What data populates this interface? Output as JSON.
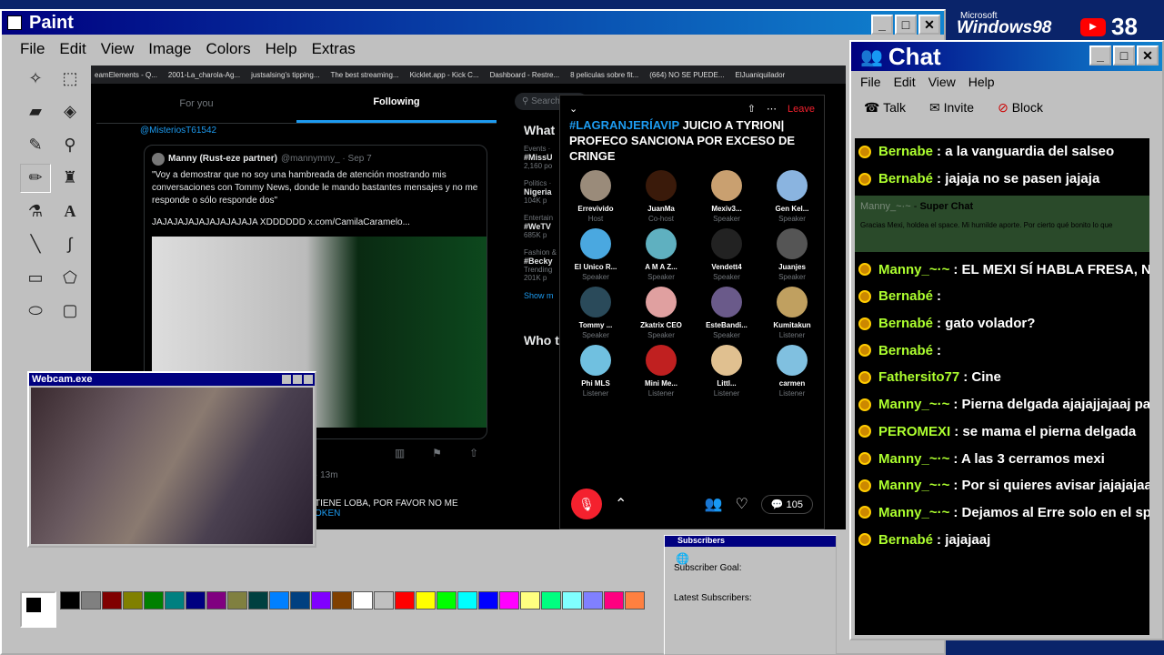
{
  "desktop": {
    "brand_top": "Microsoft",
    "brand": "Windows98",
    "youtube_count": "38"
  },
  "paint": {
    "title": "Paint",
    "menu": [
      "File",
      "Edit",
      "View",
      "Image",
      "Colors",
      "Help",
      "Extras"
    ],
    "palette": [
      "#000000",
      "#808080",
      "#800000",
      "#808000",
      "#008000",
      "#008080",
      "#000080",
      "#800080",
      "#808040",
      "#004040",
      "#0080ff",
      "#004080",
      "#8000ff",
      "#804000",
      "#ffffff",
      "#c0c0c0",
      "#ff0000",
      "#ffff00",
      "#00ff00",
      "#00ffff",
      "#0000ff",
      "#ff00ff",
      "#ffff80",
      "#00ff80",
      "#80ffff",
      "#8080ff",
      "#ff0080",
      "#ff8040"
    ]
  },
  "browser": {
    "bookmarks": [
      "eamElements - Q...",
      "2001-La_charola-Ag...",
      "justsalsing's tipping...",
      "The best streaming...",
      "Kicklet.app - Kick C...",
      "Dashboard - Restre...",
      "8 peliculas sobre fit...",
      "(664) NO SE PUEDE...",
      "ElJuaniquilador"
    ],
    "tabs": [
      "For you",
      "Following"
    ],
    "mention": "@MisteriosT61542",
    "tweet_author": "Manny (Rust-eze partner)",
    "tweet_handle": "@mannymny_ · Sep 7",
    "tweet_text": "\"Voy a demostrar que no soy una hambreada de atención mostrando mis conversaciones con Tommy News, donde le mando bastantes mensajes y no me responde o sólo responde dos\"",
    "tweet_laugh": "JAJAJAJAJAJAJAJAJAJA XDDDDDD  x.com/CamilaCaramelo...",
    "tweet2_time": "· 13m",
    "tweet2_text": "TIENE LOBA, POR FAVOR NO ME",
    "tweet2_link": "OKEN",
    "search": "Search",
    "trends_title": "What",
    "trends": [
      {
        "cat": "Events ·",
        "tag": "#MissU",
        "count": "2,160 po"
      },
      {
        "cat": "Politics ·",
        "tag": "Nigeria",
        "count": "104K p"
      },
      {
        "cat": "Entertain",
        "tag": "#WeTV",
        "count": "685K p"
      },
      {
        "cat": "Fashion &",
        "tag": "#Becky",
        "count": "Trending"
      },
      {
        "cat": "",
        "tag": "",
        "count": "201K p"
      }
    ],
    "show_more": "Show m",
    "who_to_follow": "Who t"
  },
  "space": {
    "leave": "Leave",
    "hashtag": "#LAGRANJERÍAVIP",
    "title_rest": "JUICIO A TYRION| PROFECO SANCIONA POR EXCESO DE CRINGE",
    "participants": [
      {
        "name": "Errevivido",
        "role": "Host"
      },
      {
        "name": "JuanMa",
        "role": "Co-host"
      },
      {
        "name": "Mexiv3...",
        "role": "Speaker"
      },
      {
        "name": "Gen Kel...",
        "role": "Speaker"
      },
      {
        "name": "El Unico R...",
        "role": "Speaker"
      },
      {
        "name": "A M A Z...",
        "role": "Speaker"
      },
      {
        "name": "Vendett4",
        "role": "Speaker"
      },
      {
        "name": "Juanjes",
        "role": "Speaker"
      },
      {
        "name": "Tommy ...",
        "role": "Speaker"
      },
      {
        "name": "Zkatrix CEO",
        "role": "Speaker"
      },
      {
        "name": "EsteBandi...",
        "role": "Speaker"
      },
      {
        "name": "Kumitakun",
        "role": "Listener"
      },
      {
        "name": "Phi MLS",
        "role": "Listener"
      },
      {
        "name": "Mini Me...",
        "role": "Listener"
      },
      {
        "name": "Littl...",
        "role": "Listener"
      },
      {
        "name": "carmen",
        "role": "Listener"
      }
    ],
    "comment_count": "105"
  },
  "webcam": {
    "title": "Webcam.exe"
  },
  "subscribers": {
    "title": "Subscribers",
    "goal": "Subscriber Goal:",
    "latest": "Latest Subscribers:"
  },
  "chat": {
    "title": "Chat",
    "menu": [
      "File",
      "Edit",
      "View",
      "Help"
    ],
    "actions": [
      "Talk",
      "Invite",
      "Block"
    ],
    "superchat": {
      "user": "Manny_~·~",
      "label": "Super Chat",
      "text": "Gracias Mexi, holdea el space. Mi humilde aporte. Por cierto qué bonito lo que"
    },
    "messages_top": [
      {
        "user": "Bernabe",
        "text": ": a la vanguardia del salseo"
      },
      {
        "user": "Bernabé",
        "text": ":  jajaja no se pasen jajaja"
      }
    ],
    "messages": [
      {
        "user": "Manny_~·~",
        "text": ": EL MEXI SÍ HABLA FRESA, NO T"
      },
      {
        "user": "Bernabé",
        "text": ":"
      },
      {
        "user": "Bernabé",
        "text": ": gato volador?"
      },
      {
        "user": "Bernabé",
        "text": ":"
      },
      {
        "user": "Fathersito77",
        "text": ": Cine"
      },
      {
        "user": "Manny_~·~",
        "text": ": Pierna delgada ajajajjajaaj pare"
      },
      {
        "user": "PEROMEXI",
        "text": ": se mama el pierna delgada"
      },
      {
        "user": "Manny_~·~",
        "text": ": A las 3 cerramos mexi"
      },
      {
        "user": "Manny_~·~",
        "text": ": Por si quieres avisar jajajajaa"
      },
      {
        "user": "Manny_~·~",
        "text": ": Dejamos al Erre solo en el spac"
      },
      {
        "user": "Bernabé",
        "text": ": jajajaaj"
      }
    ]
  }
}
